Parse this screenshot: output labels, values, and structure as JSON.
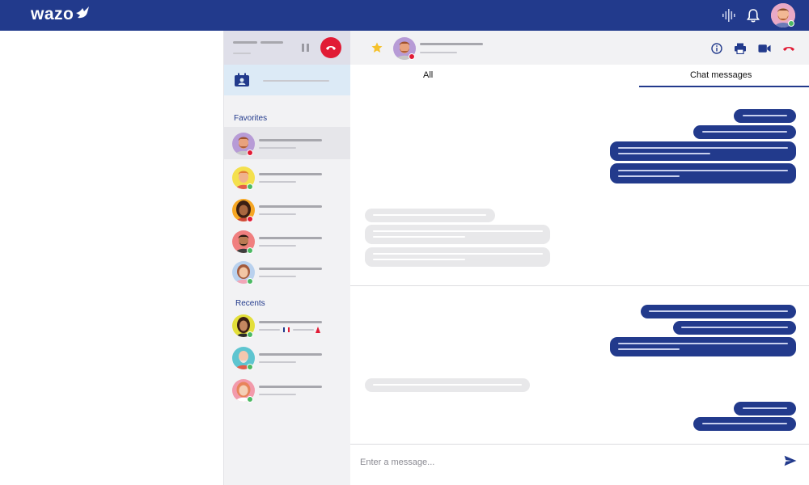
{
  "topbar": {
    "logo_text": "wazo",
    "icons": [
      "voicemail-waveform-icon",
      "bell-icon",
      "user-avatar"
    ],
    "user_status": "online"
  },
  "contacts_panel": {
    "active_call": {
      "status": "in-call",
      "actions": [
        "pause-icon",
        "hangup-icon"
      ]
    },
    "favorites_title": "Favorites",
    "favorites": [
      {
        "status": "busy",
        "active": true
      },
      {
        "status": "online"
      },
      {
        "status": "busy"
      },
      {
        "status": "online"
      },
      {
        "status": "online"
      }
    ],
    "recents_title": "Recents",
    "recents": [
      {
        "status": "online"
      },
      {
        "status": "online"
      },
      {
        "status": "online"
      }
    ]
  },
  "chat": {
    "header_icons": [
      "star-icon",
      "info-icon",
      "printer-icon",
      "video-camera-icon",
      "hangup-icon"
    ],
    "contact_status": "busy",
    "tabs": [
      {
        "label": "All",
        "active": false
      },
      {
        "label": "Chat messages",
        "active": true
      }
    ],
    "composer": {
      "placeholder": "Enter a message...",
      "send_icon": "send-icon"
    }
  },
  "colors": {
    "brand": "#223a8c",
    "danger": "#e11b35",
    "online": "#4cb963",
    "star": "#f5c12b",
    "panel_bg": "#f2f2f4"
  }
}
